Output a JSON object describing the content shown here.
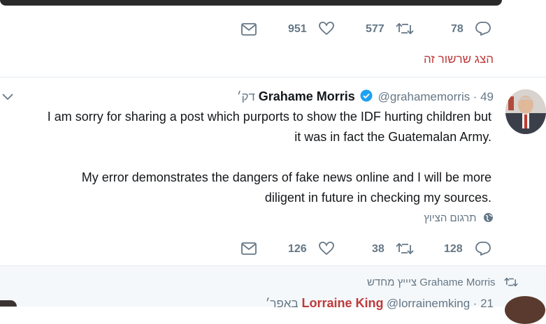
{
  "tweet1": {
    "actions": {
      "likes": "951",
      "retweets": "577",
      "replies": "78"
    },
    "show_thread": "הצג שרשור זה"
  },
  "tweet2": {
    "author": {
      "name": "Grahame Morris",
      "handle": "@grahamemorris",
      "time": "49 דק׳"
    },
    "text": "I am sorry for sharing a post which purports to show the IDF hurting children but\nit was in fact the Guatemalan Army.\n\nMy error demonstrates the dangers of fake news online and I will be more\ndiligent in future in checking my sources.",
    "translate": "תרגום הציוץ",
    "actions": {
      "likes": "126",
      "retweets": "38",
      "replies": "128"
    }
  },
  "tweet3": {
    "retweeted_by": "Grahame Morris ציייץ מחדש",
    "author": {
      "name": "Lorraine King",
      "handle": "@lorrainemking",
      "time": "21 באפר׳"
    }
  },
  "colors": {
    "accent": "#1da1f2",
    "link_red": "#bf3a3a",
    "muted": "#657786"
  }
}
